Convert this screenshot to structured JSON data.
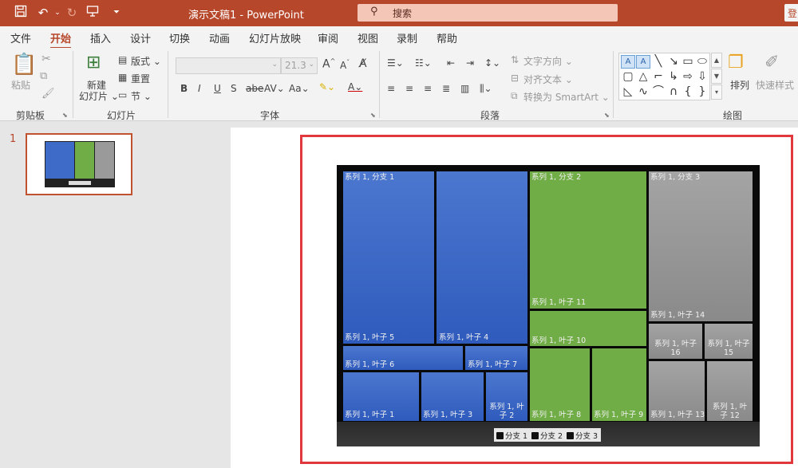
{
  "titlebar": {
    "doc_title": "演示文稿1  -  PowerPoint",
    "search_placeholder": "搜索",
    "signin_label": "登"
  },
  "menu_tabs": [
    "文件",
    "开始",
    "插入",
    "设计",
    "切换",
    "动画",
    "幻灯片放映",
    "审阅",
    "视图",
    "录制",
    "帮助"
  ],
  "ribbon": {
    "clipboard": {
      "paste": "粘贴",
      "label": "剪贴板"
    },
    "slides": {
      "new_slide_1": "新建",
      "new_slide_2": "幻灯片",
      "layout": "版式",
      "reset": "重置",
      "section": "节",
      "label": "幻灯片"
    },
    "font": {
      "font_size": "21.3",
      "label": "字体"
    },
    "paragraph": {
      "text_direction": "文字方向",
      "align_text": "对齐文本",
      "smartart": "转换为 SmartArt",
      "label": "段落"
    },
    "drawing": {
      "arrange": "排列",
      "quick_styles": "快速样式",
      "label": "绘图"
    }
  },
  "thumbnail": {
    "slide_number": "1"
  },
  "colors": {
    "accent": "#b7472a",
    "branch1": "#4472c4",
    "branch2": "#70ad47",
    "branch3": "#a5a5a5"
  },
  "chart_data": {
    "type": "treemap",
    "branches": [
      {
        "name": "分支 1",
        "leaves": [
          "叶子 1",
          "叶子 2",
          "叶子 3",
          "叶子 4",
          "叶子 5",
          "叶子 6",
          "叶子 7"
        ]
      },
      {
        "name": "分支 2",
        "leaves": [
          "叶子 8",
          "叶子 9",
          "叶子 10",
          "叶子 11"
        ]
      },
      {
        "name": "分支 3",
        "leaves": [
          "叶子 12",
          "叶子 13",
          "叶子 14",
          "叶子 15",
          "叶子 16"
        ]
      }
    ],
    "labels": {
      "b1": "系列 1, 分支 1",
      "b2": "系列 1, 分支 2",
      "b3": "系列 1, 分支 3",
      "l1": "系列 1, 叶子 1",
      "l2": "系列 1, 叶子 2",
      "l3": "系列 1, 叶子 3",
      "l4": "系列 1, 叶子 4",
      "l5": "系列 1, 叶子 5",
      "l6": "系列 1, 叶子 6",
      "l7": "系列 1, 叶子 7",
      "l8": "系列 1, 叶子 8",
      "l9": "系列 1, 叶子 9",
      "l10": "系列 1, 叶子 10",
      "l11": "系列 1, 叶子 11",
      "l12": "系列 1, 叶子 12",
      "l13": "系列 1, 叶子 13",
      "l14": "系列 1, 叶子 14",
      "l15": "系列 1, 叶子 15",
      "l16": "系列 1, 叶子 16"
    },
    "legend": [
      "分支 1",
      "分支 2",
      "分支 3"
    ]
  }
}
